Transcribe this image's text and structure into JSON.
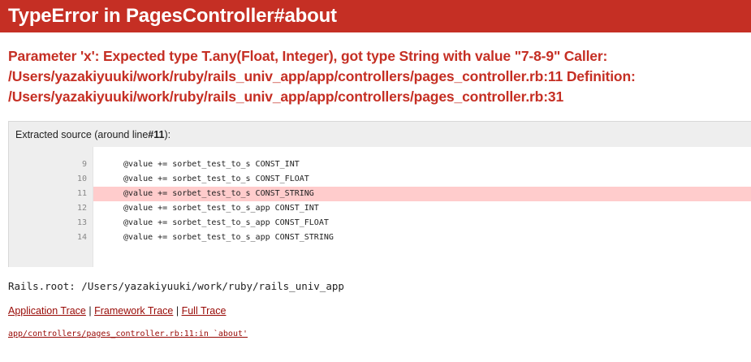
{
  "header": {
    "title": "TypeError in PagesController#about"
  },
  "error": {
    "message": "Parameter 'x': Expected type T.any(Float, Integer), got type String with value \"7-8-9\" Caller: /Users/yazakiyuuki/work/ruby/rails_univ_app/app/controllers/pages_controller.rb:11 Definition: /Users/yazakiyuuki/work/ruby/rails_univ_app/app/controllers/pages_controller.rb:31"
  },
  "source": {
    "title_prefix": "Extracted source (around line ",
    "title_line": "#11",
    "title_suffix": "):",
    "lines": [
      {
        "num": "9",
        "code": "@value += sorbet_test_to_s CONST_INT"
      },
      {
        "num": "10",
        "code": "@value += sorbet_test_to_s CONST_FLOAT"
      },
      {
        "num": "11",
        "code": "@value += sorbet_test_to_s CONST_STRING",
        "highlight": true
      },
      {
        "num": "12",
        "code": "@value += sorbet_test_to_s_app CONST_INT"
      },
      {
        "num": "13",
        "code": "@value += sorbet_test_to_s_app CONST_FLOAT"
      },
      {
        "num": "14",
        "code": "@value += sorbet_test_to_s_app CONST_STRING"
      }
    ],
    "highlight_color": "#ffcccc"
  },
  "rails_root": "Rails.root: /Users/yazakiyuuki/work/ruby/rails_univ_app",
  "traces": {
    "application": "Application Trace",
    "framework": "Framework Trace",
    "full": "Full Trace",
    "separator": "|"
  },
  "trace_entry": "app/controllers/pages_controller.rb:11:in `about'",
  "colors": {
    "header_bg": "#c52f24",
    "message": "#c52f24",
    "link": "#980905"
  }
}
